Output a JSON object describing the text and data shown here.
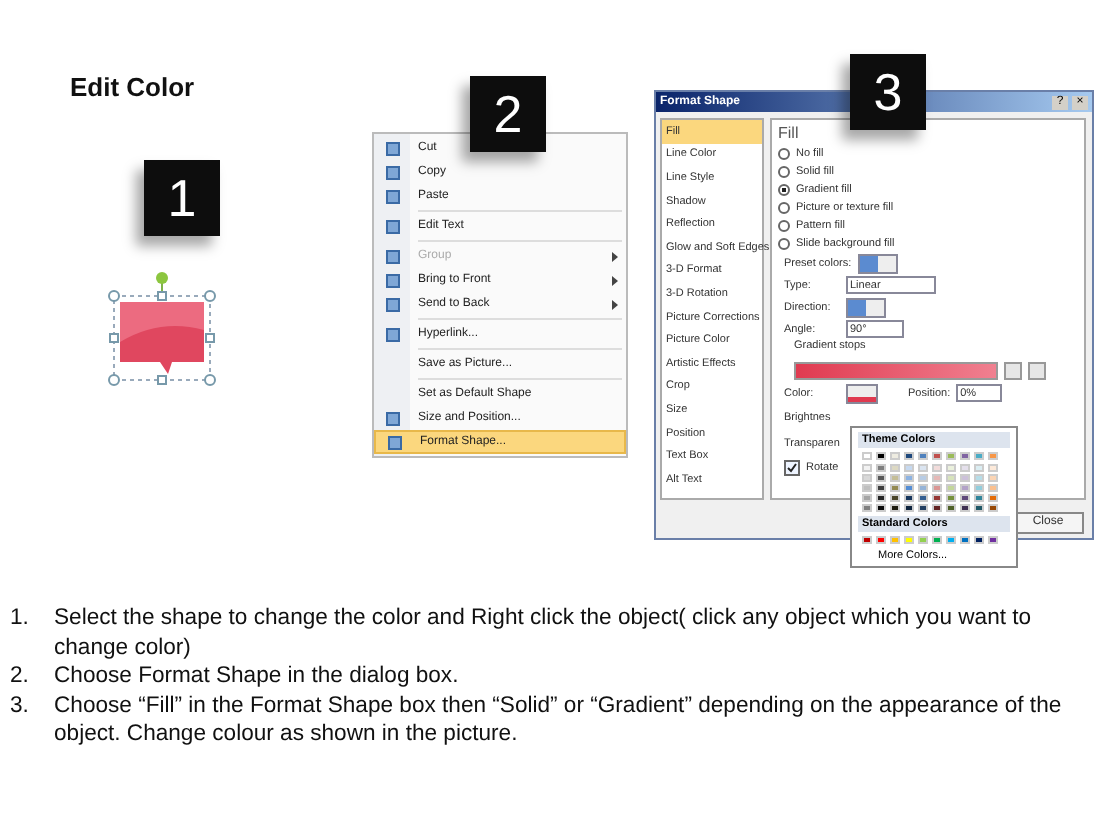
{
  "slide": {
    "title": "Edit Color"
  },
  "step_badges": [
    {
      "number": "1"
    },
    {
      "number": "2"
    },
    {
      "number": "3"
    }
  ],
  "context_menu": {
    "sections": [
      {
        "items": [
          {
            "label": "Cut",
            "icon": true,
            "disabled": false,
            "submenu": false,
            "selected": false
          },
          {
            "label": "Copy",
            "icon": true,
            "disabled": false,
            "submenu": false,
            "selected": false
          },
          {
            "label": "Paste",
            "icon": true,
            "disabled": false,
            "submenu": false,
            "selected": false
          }
        ]
      },
      {
        "items": [
          {
            "label": "Edit Text",
            "icon": true,
            "disabled": false,
            "submenu": false,
            "selected": false
          }
        ]
      },
      {
        "items": [
          {
            "label": "Group",
            "icon": true,
            "disabled": true,
            "submenu": true,
            "selected": false
          },
          {
            "label": "Bring to Front",
            "icon": true,
            "disabled": false,
            "submenu": true,
            "selected": false
          },
          {
            "label": "Send to Back",
            "icon": true,
            "disabled": false,
            "submenu": true,
            "selected": false
          }
        ]
      },
      {
        "items": [
          {
            "label": "Hyperlink...",
            "icon": true,
            "disabled": false,
            "submenu": false,
            "selected": false
          }
        ]
      },
      {
        "items": [
          {
            "label": "Save as Picture...",
            "icon": false,
            "disabled": false,
            "submenu": false,
            "selected": false
          }
        ]
      },
      {
        "items": [
          {
            "label": "Set as Default Shape",
            "icon": false,
            "disabled": false,
            "submenu": false,
            "selected": false
          },
          {
            "label": "Size and Position...",
            "icon": true,
            "disabled": false,
            "submenu": false,
            "selected": false
          },
          {
            "label": "Format Shape...",
            "icon": true,
            "disabled": false,
            "submenu": false,
            "selected": true
          }
        ]
      }
    ]
  },
  "format_shape_dialog": {
    "title": "Format Shape",
    "help_glyph": "?",
    "close_glyph": "×",
    "categories": [
      {
        "label": "Fill",
        "selected": true
      },
      {
        "label": "Line Color",
        "selected": false
      },
      {
        "label": "Line Style",
        "selected": false
      },
      {
        "label": "Shadow",
        "selected": false
      },
      {
        "label": "Reflection",
        "selected": false
      },
      {
        "label": "Glow and Soft Edges",
        "selected": false
      },
      {
        "label": "3-D Format",
        "selected": false
      },
      {
        "label": "3-D Rotation",
        "selected": false
      },
      {
        "label": "Picture Corrections",
        "selected": false
      },
      {
        "label": "Picture Color",
        "selected": false
      },
      {
        "label": "Artistic Effects",
        "selected": false
      },
      {
        "label": "Crop",
        "selected": false
      },
      {
        "label": "Size",
        "selected": false
      },
      {
        "label": "Position",
        "selected": false
      },
      {
        "label": "Text Box",
        "selected": false
      },
      {
        "label": "Alt Text",
        "selected": false
      }
    ],
    "fill": {
      "heading": "Fill",
      "options": [
        {
          "label": "No fill",
          "selected": false
        },
        {
          "label": "Solid fill",
          "selected": false
        },
        {
          "label": "Gradient fill",
          "selected": true
        },
        {
          "label": "Picture or texture fill",
          "selected": false
        },
        {
          "label": "Pattern fill",
          "selected": false
        },
        {
          "label": "Slide background fill",
          "selected": false
        }
      ],
      "preset_colors_label": "Preset colors:",
      "type_label": "Type:",
      "type_value": "Linear",
      "direction_label": "Direction:",
      "angle_label": "Angle:",
      "angle_value": "90°",
      "gradient_stops_label": "Gradient stops",
      "color_label": "Color:",
      "position_label": "Position:",
      "position_value": "0%",
      "brightness_label": "Brightnes",
      "transparency_label": "Transparen",
      "rotate": {
        "label": "Rotate",
        "checked": true
      }
    },
    "close_button": "Close"
  },
  "color_popup": {
    "theme_heading": "Theme Colors",
    "standard_heading": "Standard Colors",
    "more_colors": "More Colors..."
  },
  "instructions": [
    {
      "number": "1.",
      "text": "Select the shape to change the color and Right click the object( click any object which you want to change color)"
    },
    {
      "number": "2.",
      "text": "Choose Format Shape in the dialog box."
    },
    {
      "number": "3.",
      "text": "Choose “Fill” in the Format Shape box then “Solid” or “Gradient” depending on the appearance of the object. Change colour as shown in the picture."
    }
  ]
}
